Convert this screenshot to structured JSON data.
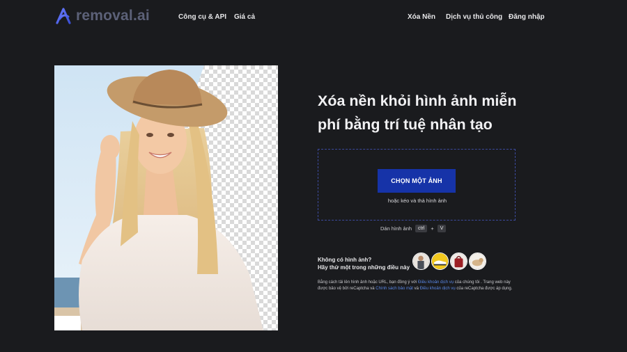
{
  "nav": {
    "logo_text": "removal.ai",
    "left_links": [
      "Công cụ & API",
      "Giá cả"
    ],
    "right_links": [
      "Xóa Nền",
      "Dịch vụ thủ công",
      "Đăng nhập"
    ]
  },
  "hero_image": {
    "alt": "woman-with-hat-background-removal-preview"
  },
  "main": {
    "headline_line1": "Xóa nền khỏi hình ảnh miễn",
    "headline_line2": "phí bằng trí tuệ nhân tạo",
    "upload_button": "CHỌN MỘT ẢNH",
    "drag_hint": "hoặc kéo và thả hình ảnh",
    "paste_label": "Dán hình ảnh",
    "paste_key1": "ctrl",
    "paste_plus": "+",
    "paste_key2": "V"
  },
  "samples": {
    "line1": "Không có hình ảnh?",
    "line2": "Hãy thử một trong những điều này",
    "items": [
      "sample-person",
      "sample-shoe",
      "sample-bag",
      "sample-dog"
    ]
  },
  "legal": {
    "part1": "Bằng cách tải lên hình ảnh hoặc URL, bạn đồng ý với ",
    "link1": "Điều khoản dịch vụ",
    "part2": " của chúng tôi . Trang web này được bảo vệ bởi reCaptcha và ",
    "link2": "Chính sách bảo mật",
    "part3": " và ",
    "link3": "Điều khoản dịch vụ",
    "part4": " của reCaptcha được áp dụng."
  },
  "colors": {
    "background": "#1a1b1e",
    "accent": "#1633a8",
    "link": "#5a88e6",
    "dropzone_border": "#3c4a9e"
  }
}
